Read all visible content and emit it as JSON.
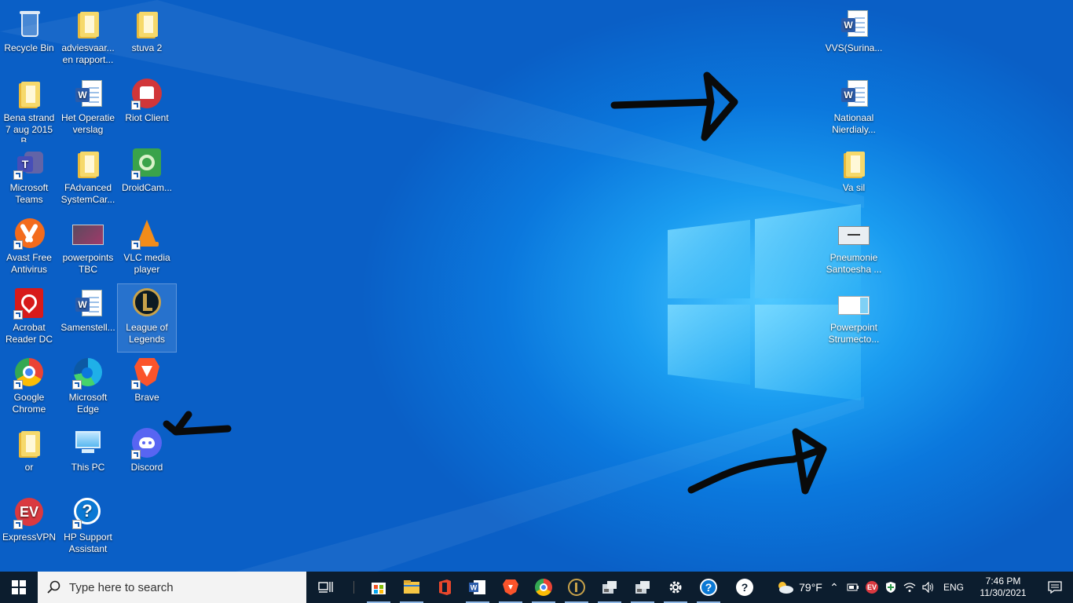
{
  "desktop": {
    "icons": [
      {
        "label": "Recycle Bin"
      },
      {
        "label": "adviesvaar... en rapport..."
      },
      {
        "label": "stuva 2"
      },
      {
        "label": "Bena strand 7 aug 2015 B...."
      },
      {
        "label": "Het  Operatie verslag"
      },
      {
        "label": "Riot Client"
      },
      {
        "label": "Microsoft Teams"
      },
      {
        "label": "FAdvanced SystemCar..."
      },
      {
        "label": "DroidCam..."
      },
      {
        "label": "Avast Free Antivirus"
      },
      {
        "label": "powerpoints TBC"
      },
      {
        "label": "VLC media player"
      },
      {
        "label": "Acrobat Reader DC"
      },
      {
        "label": "Samenstell..."
      },
      {
        "label": "League of Legends"
      },
      {
        "label": "Google Chrome"
      },
      {
        "label": "Microsoft Edge"
      },
      {
        "label": "Brave"
      },
      {
        "label": "or"
      },
      {
        "label": "This PC"
      },
      {
        "label": "Discord"
      },
      {
        "label": "ExpressVPN"
      },
      {
        "label": "HP Support Assistant"
      },
      {
        "label": "VVS(Surina..."
      },
      {
        "label": "Nationaal Nierdialy..."
      },
      {
        "label": "Va sil"
      },
      {
        "label": "Pneumonie Santoesha ..."
      },
      {
        "label": "Powerpoint Strumecto..."
      }
    ]
  },
  "taskbar": {
    "search_placeholder": "Type here to search",
    "weather_temp": "79°F",
    "language": "ENG",
    "time": "7:46 PM",
    "date": "11/30/2021"
  }
}
